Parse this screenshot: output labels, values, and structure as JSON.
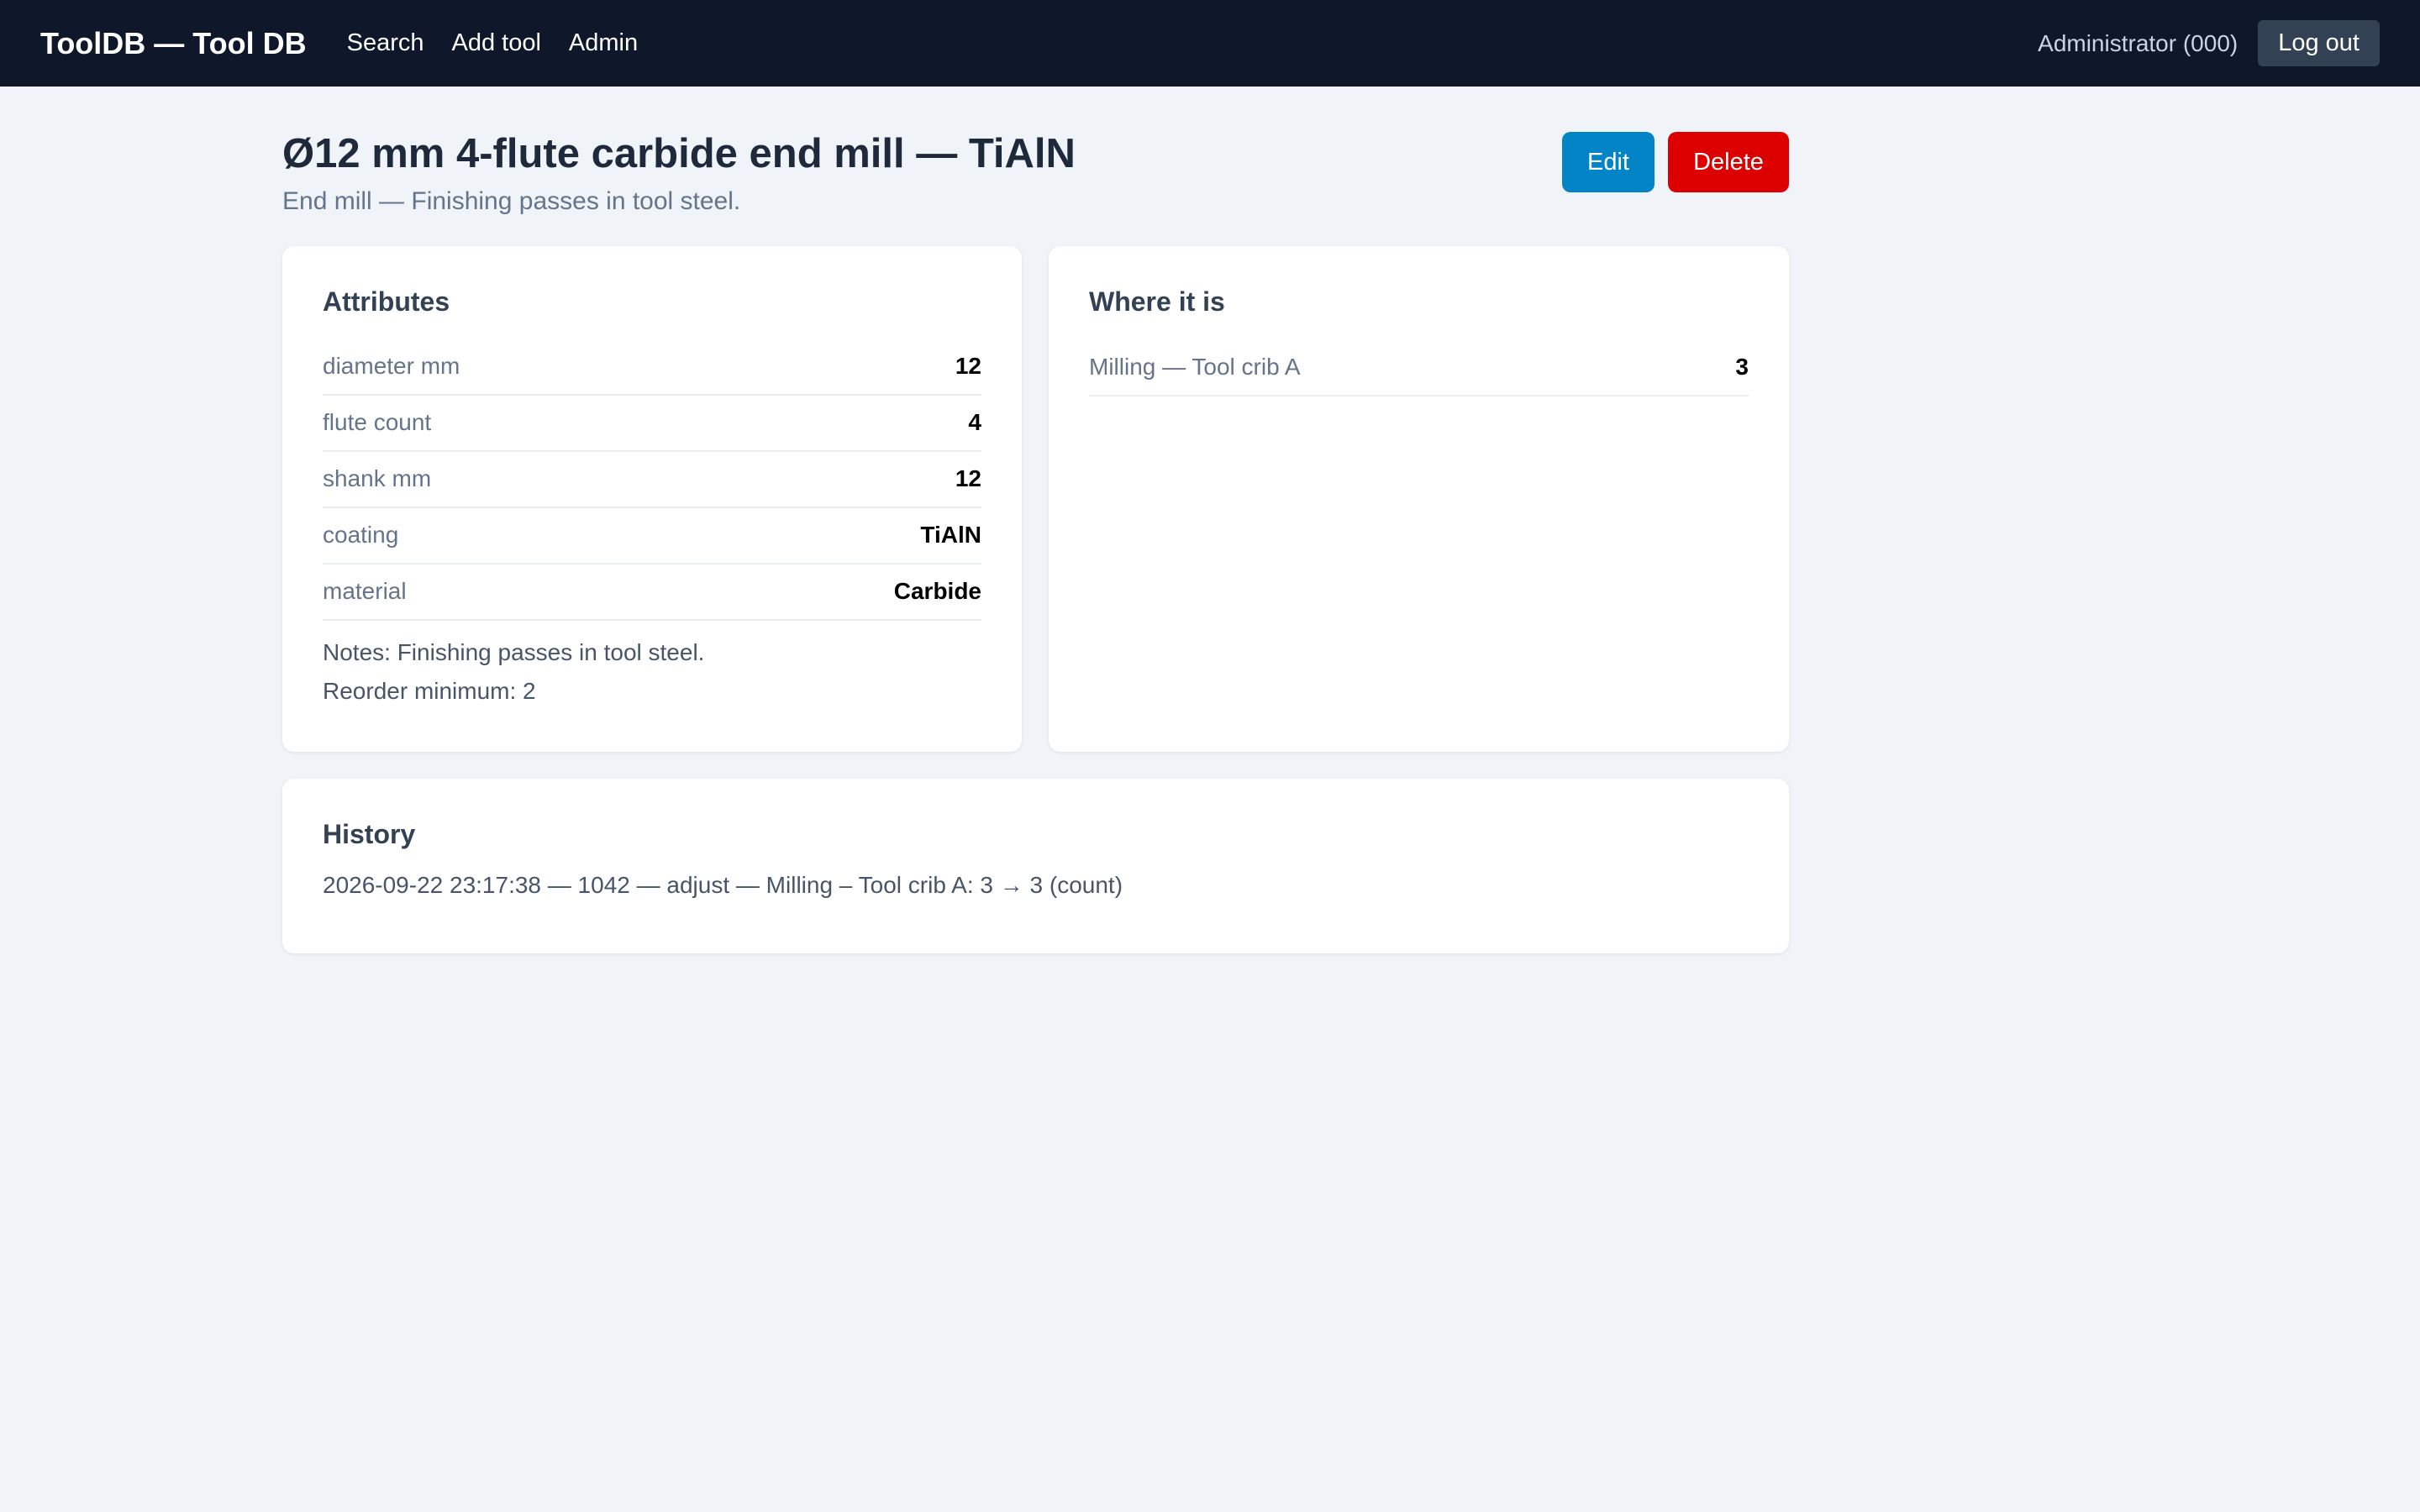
{
  "nav": {
    "brand": "ToolDB — Tool DB",
    "links": [
      "Search",
      "Add tool",
      "Admin"
    ],
    "user": "Administrator (000)",
    "logout": "Log out"
  },
  "tool": {
    "title": "Ø12 mm 4-flute carbide end mill — TiAlN",
    "subtitle": "End mill — Finishing passes in tool steel.",
    "edit_label": "Edit",
    "delete_label": "Delete"
  },
  "attributes": {
    "heading": "Attributes",
    "rows": [
      {
        "label": "diameter mm",
        "value": "12"
      },
      {
        "label": "flute count",
        "value": "4"
      },
      {
        "label": "shank mm",
        "value": "12"
      },
      {
        "label": "coating",
        "value": "TiAlN"
      },
      {
        "label": "material",
        "value": "Carbide"
      }
    ],
    "notes": "Notes: Finishing passes in tool steel.",
    "reorder": "Reorder minimum: 2"
  },
  "locations": {
    "heading": "Where it is",
    "rows": [
      {
        "label": "Milling — Tool crib A",
        "value": "3"
      }
    ]
  },
  "history": {
    "heading": "History",
    "items": [
      "2026-09-22 23:17:38 — 1042 — adjust — Milling – Tool crib A: 3 → 3 (count)"
    ]
  },
  "colors": {
    "topbar": "#0f172a",
    "edit": "#0284c7",
    "delete": "#dc0000",
    "background": "#f0f4f8"
  }
}
